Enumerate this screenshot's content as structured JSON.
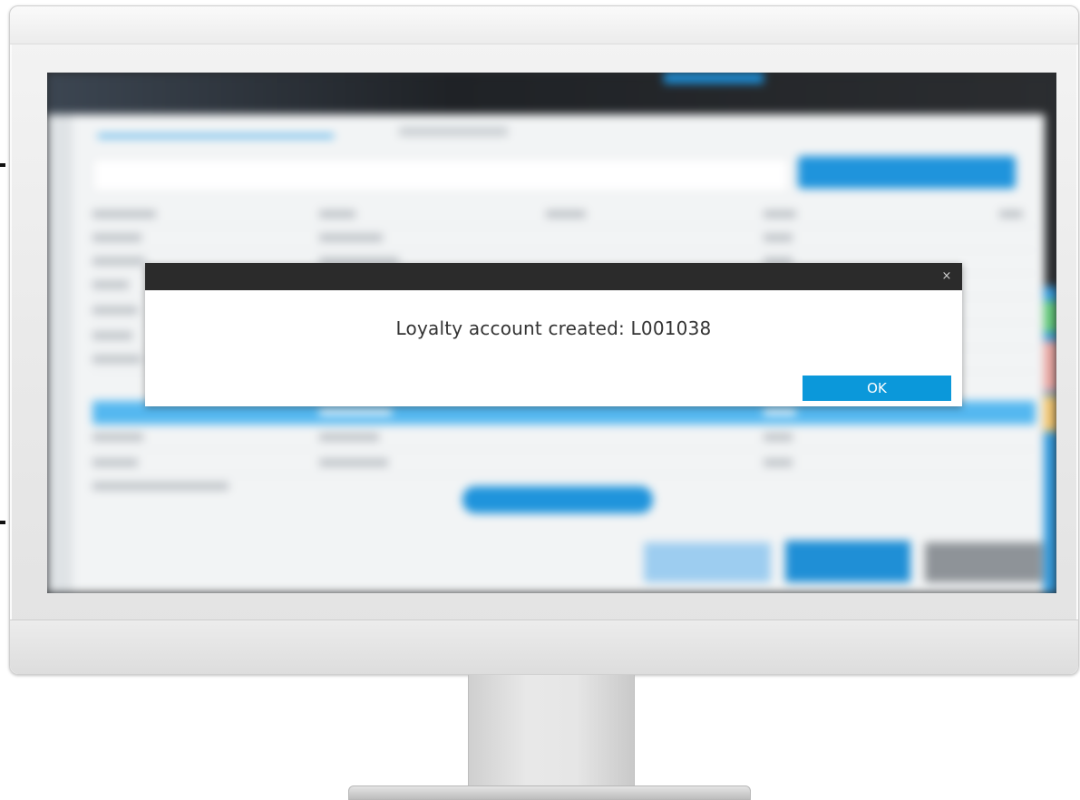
{
  "dialog": {
    "message": "Loyalty account created: L001038",
    "ok_label": "OK",
    "close_glyph": "×"
  },
  "colors": {
    "dialog_header": "#2b2b2b",
    "ok_button": "#0b98da",
    "app_accent": "#1f94dc"
  },
  "icons": {
    "close": "close-icon"
  }
}
